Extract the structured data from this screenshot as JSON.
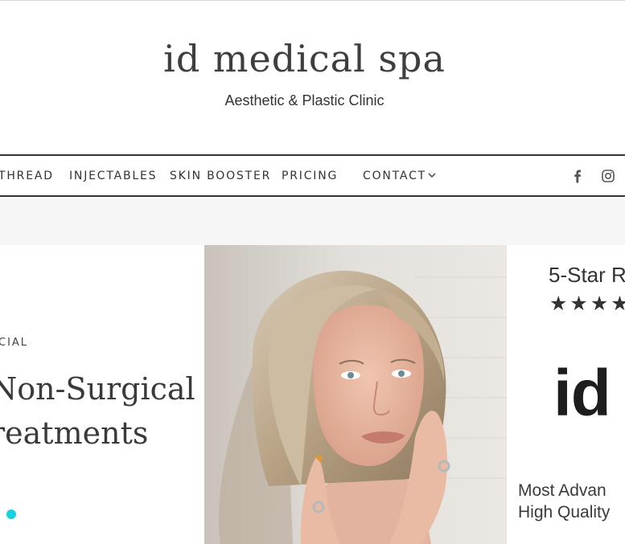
{
  "header": {
    "logo": "id medical spa",
    "tagline": "Aesthetic & Plastic Clinic"
  },
  "nav": {
    "items": [
      {
        "label": "THREAD"
      },
      {
        "label": "INJECTABLES"
      },
      {
        "label": "SKIN BOOSTER"
      },
      {
        "label": "PRICING"
      },
      {
        "label": "CONTACT"
      }
    ],
    "social": [
      "facebook-icon",
      "instagram-icon"
    ]
  },
  "hero_slide": {
    "eyebrow": "CIAL",
    "headline_line1": "Non-Surgical",
    "headline_line2": "reatments",
    "dot_color": "#19d1de"
  },
  "promo": {
    "rating_title": "5-Star R",
    "stars": "★★★★",
    "brand_mark": "id",
    "line1": "Most Advan",
    "line2": "High Quality"
  },
  "colors": {
    "text": "#333333",
    "accent": "#19d1de",
    "subbar": "#f6f6f6"
  }
}
